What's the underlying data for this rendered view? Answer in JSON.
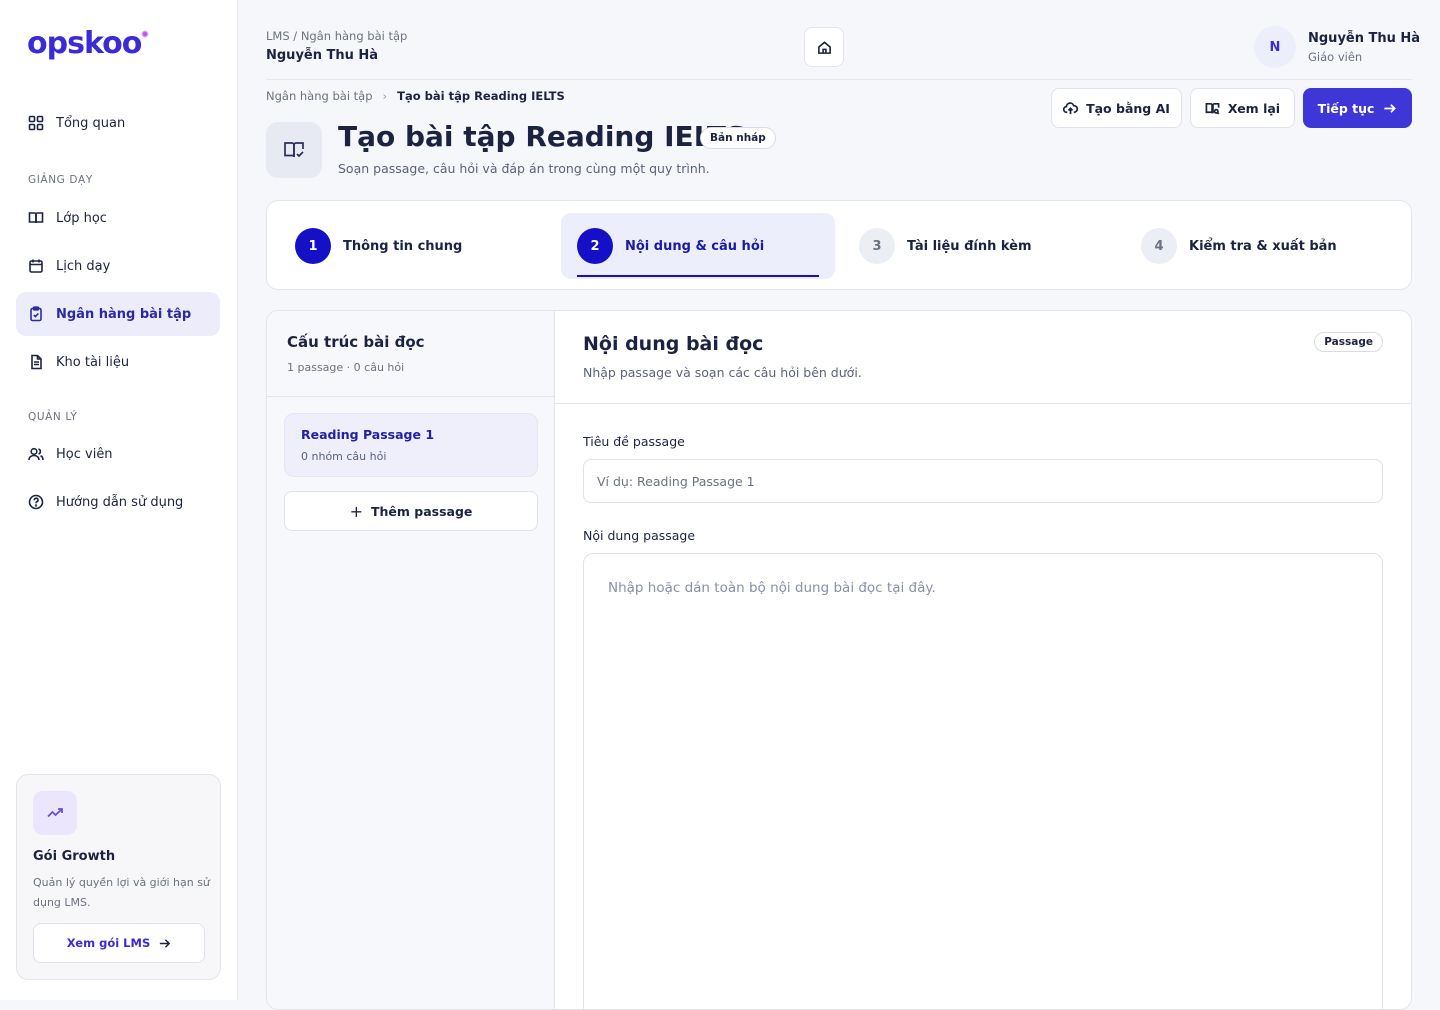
{
  "app": {
    "logo_text": "opskoo"
  },
  "sidebar": {
    "items": [
      {
        "label": "Tổng quan"
      },
      {
        "label": "Lớp học"
      },
      {
        "label": "Lịch dạy"
      },
      {
        "label": "Ngân hàng bài tập"
      },
      {
        "label": "Kho tài liệu"
      },
      {
        "label": "Học viên"
      },
      {
        "label": "Hướng dẫn sử dụng"
      }
    ],
    "sections": {
      "teaching": "GIẢNG DẠY",
      "management": "QUẢN LÝ"
    },
    "plan": {
      "title": "Gói Growth",
      "description": "Quản lý quyền lợi và giới hạn sử dụng LMS.",
      "button": "Xem gói LMS"
    }
  },
  "header": {
    "breadcrumb": "LMS / Ngân hàng bài tập",
    "subtitle": "Nguyễn Thu Hà",
    "user": {
      "initial": "N",
      "name": "Nguyễn Thu Hà",
      "role": "Giáo viên"
    }
  },
  "page": {
    "breadcrumb": {
      "parent": "Ngân hàng bài tập",
      "current": "Tạo bài tập Reading IELTS"
    },
    "title": "Tạo bài tập Reading IELTS",
    "badge": "Bản nháp",
    "subtitle": "Soạn passage, câu hỏi và đáp án trong cùng một quy trình.",
    "actions": {
      "ai": "Tạo bằng AI",
      "preview": "Xem lại",
      "next": "Tiếp tục"
    }
  },
  "steps": [
    {
      "num": "1",
      "label": "Thông tin chung",
      "state": "done"
    },
    {
      "num": "2",
      "label": "Nội dung & câu hỏi",
      "state": "active"
    },
    {
      "num": "3",
      "label": "Tài liệu đính kèm",
      "state": "pending"
    },
    {
      "num": "4",
      "label": "Kiểm tra & xuất bản",
      "state": "pending"
    }
  ],
  "structure": {
    "title": "Cấu trúc bài đọc",
    "meta": "1 passage · 0 câu hỏi",
    "passages": [
      {
        "name": "Reading Passage 1",
        "count": "0 nhóm câu hỏi"
      }
    ],
    "add_button": "Thêm passage"
  },
  "content": {
    "title": "Nội dung bài đọc",
    "subtitle": "Nhập passage và soạn các câu hỏi bên dưới.",
    "badge": "Passage",
    "title_label": "Tiêu đề passage",
    "title_placeholder": "Ví dụ: Reading Passage 1",
    "title_value": "",
    "body_label": "Nội dung passage",
    "body_placeholder": "Nhập hoặc dán toàn bộ nội dung bài đọc tại đây.",
    "body_value": ""
  },
  "colors": {
    "primary": "#3f36d8",
    "step_active": "#1510c8",
    "accent_text": "#2320a8"
  }
}
